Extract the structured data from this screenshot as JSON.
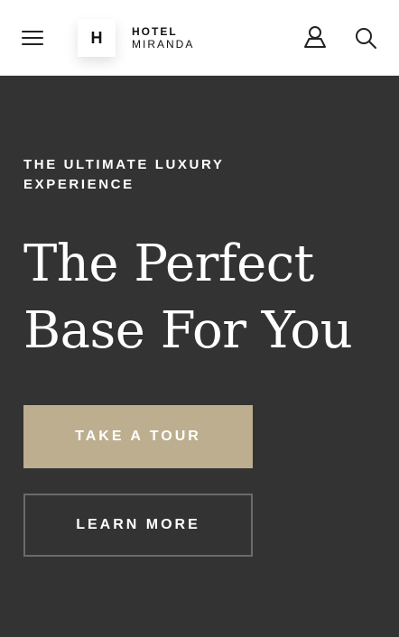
{
  "header": {
    "logo": {
      "mark": "H",
      "line1": "HOTEL",
      "line2": "MIRANDA"
    },
    "icons": {
      "menu": "hamburger-menu-icon",
      "account": "user-icon",
      "search": "search-icon"
    }
  },
  "hero": {
    "eyebrow": "THE ULTIMATE LUXURY EXPERIENCE",
    "headline": "The Perfect Base For You",
    "primary_button": "TAKE A TOUR",
    "secondary_button": "LEARN MORE"
  },
  "colors": {
    "header_bg": "#ffffff",
    "hero_bg": "#333333",
    "accent": "#bcae8e",
    "text_light": "#ffffff",
    "button_border": "#6b6b6b"
  }
}
